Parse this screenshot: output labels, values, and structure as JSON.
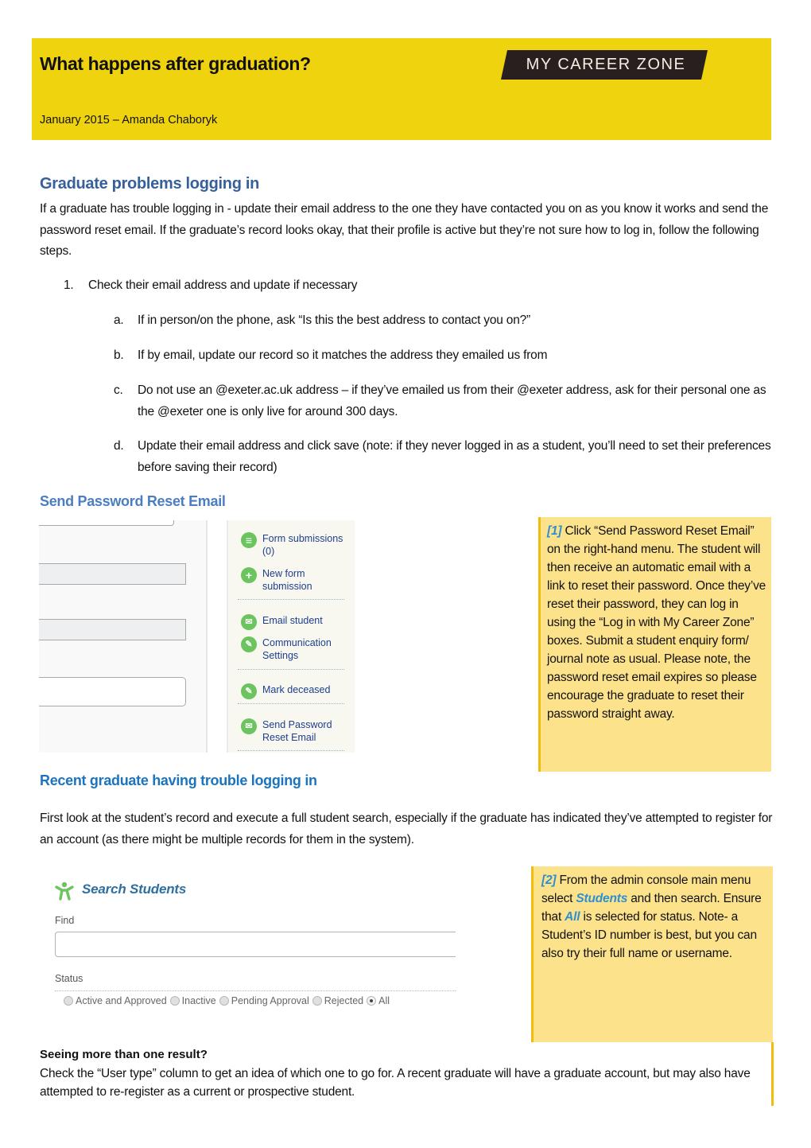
{
  "header": {
    "title": "What happens after graduation?",
    "subtitle": "January 2015 – Amanda Chaboryk",
    "logo_text": "MY CAREER ZONE",
    "background_color": "#efd30f"
  },
  "section_login": {
    "heading": "Graduate problems logging in",
    "intro": "If a graduate has trouble logging in - update their email address to the one they have contacted you on as you know it works and send the password reset email.  If the graduate’s record looks okay, that their profile is active but they’re not sure how to log in, follow the following steps.",
    "steps": [
      {
        "num": "1.",
        "text": "Check their email address and update if necessary",
        "substeps": [
          {
            "label": "a.",
            "text": "If in person/on the phone, ask “Is this the best address to contact you on?”"
          },
          {
            "label": "b.",
            "text": "If by email, update our record so it matches the address they emailed us from"
          },
          {
            "label": "c.",
            "text": "Do not use an @exeter.ac.uk address – if they’ve emailed us from their @exeter address, ask for their personal one as the @exeter one is only live for around 300 days."
          },
          {
            "label": "d.",
            "text": "Update their email address and click save (note: if they never logged in as a student, you’ll need to set their preferences before saving their record)"
          }
        ]
      }
    ]
  },
  "section_reset": {
    "heading": "Send Password Reset Email",
    "menu": [
      {
        "icon": "list-icon",
        "label": "Form submissions (0)"
      },
      {
        "icon": "plus-icon",
        "label": "New form submission"
      },
      {
        "icon": "envelope-icon",
        "label": "Email student"
      },
      {
        "icon": "pencil-icon",
        "label": "Communication Settings"
      },
      {
        "icon": "pencil-icon",
        "label": "Mark deceased"
      },
      {
        "icon": "envelope-icon",
        "label": "Send Password Reset Email"
      }
    ],
    "callout": {
      "ref": "[1]",
      "text": " Click “Send Password Reset Email” on the right-hand menu. The student will then receive an automatic email with a link to reset their password.  Once they’ve reset their password, they can log in using the “Log in with My Career Zone” boxes. Submit a student enquiry form/ journal note as usual. Please note, the password reset email expires so please encourage the graduate to reset their password straight away."
    }
  },
  "section_recent": {
    "heading": "Recent graduate having trouble logging in",
    "intro": "First look at the student’s record and execute a full student search, especially if the graduate has indicated they’ve attempted to register for an account (as there might be multiple records for them in the system).",
    "search_panel": {
      "title": "Search Students",
      "find_label": "Find",
      "find_value": "",
      "status_label": "Status",
      "status_options": [
        "Active and Approved",
        "Inactive",
        "Pending Approval",
        "Rejected",
        "All"
      ],
      "status_selected": "All"
    },
    "callout": {
      "ref": "[2]",
      "part1": " From the admin console main menu select ",
      "em1": "Students",
      "part2": " and then search.  Ensure that ",
      "em2": "All",
      "part3": " is selected for status. Note- a Student’s ID number is best, but you can also try their full name or username."
    },
    "more_heading": "Seeing more than one result?",
    "more_text": "Check the “User type” column to get an idea of which one to go for. A recent graduate will have a graduate account, but may also have attempted to re-register as a current or prospective student."
  },
  "colors": {
    "heading_dark_blue": "#35609a",
    "heading_mid_blue": "#4a7ec0",
    "heading_bright_blue": "#1a74c0",
    "callout_fill": "#fde28c",
    "callout_border": "#f0bd0f",
    "accent_blue": "#2e8fd0",
    "menu_icon_green": "#6cc45e"
  }
}
